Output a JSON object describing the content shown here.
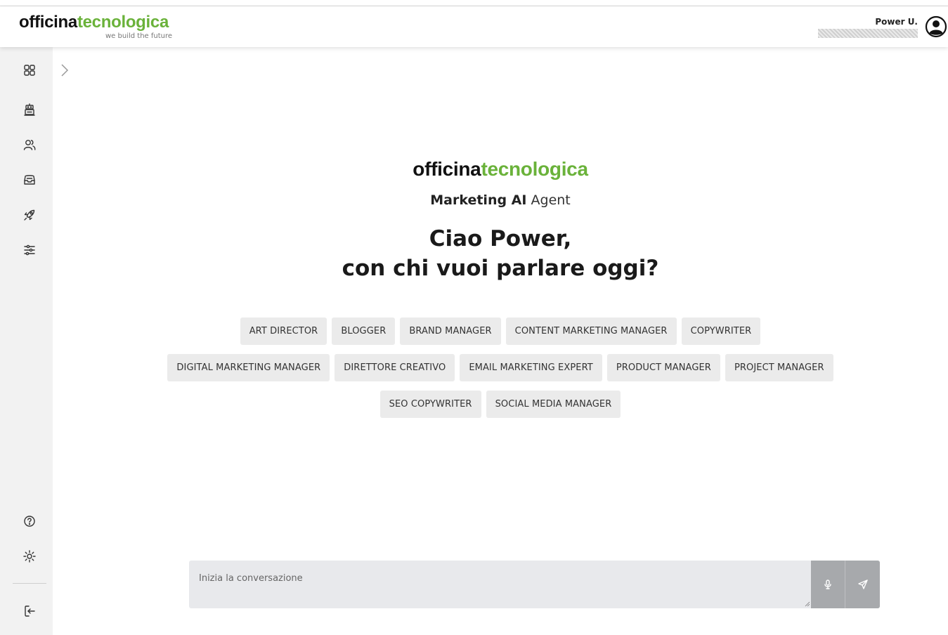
{
  "header": {
    "logo_dark": "officina",
    "logo_green": "tecnologica",
    "logo_tagline": "we build the future",
    "user_name": "Power U."
  },
  "sidebar": {
    "icons": [
      "dashboard-grid-icon",
      "robot-icon",
      "users-icon",
      "inbox-icon",
      "rocket-icon",
      "sliders-icon",
      "help-icon",
      "sun-icon",
      "logout-icon"
    ]
  },
  "hero": {
    "logo_dark": "officina",
    "logo_green": "tecnologica",
    "subtitle_bold": "Marketing AI",
    "subtitle_rest": "Agent",
    "greeting_line1": "Ciao Power,",
    "greeting_line2": "con chi vuoi parlare oggi?"
  },
  "agents": {
    "row1": [
      "ART DIRECTOR",
      "BLOGGER",
      "BRAND MANAGER",
      "CONTENT MARKETING MANAGER",
      "COPYWRITER"
    ],
    "row2": [
      "DIGITAL MARKETING MANAGER",
      "DIRETTORE CREATIVO",
      "EMAIL MARKETING EXPERT",
      "PRODUCT MANAGER",
      "PROJECT MANAGER"
    ],
    "row3": [
      "SEO COPYWRITER",
      "SOCIAL MEDIA MANAGER"
    ]
  },
  "composer": {
    "placeholder": "Inizia la conversazione",
    "value": ""
  },
  "colors": {
    "brand_green": "#6ab23a",
    "sidebar_bg": "#f2f2f2",
    "chip_bg": "#ebebeb",
    "composer_bg": "#e8e9ec",
    "composer_button_bg": "#a7a9ac"
  }
}
